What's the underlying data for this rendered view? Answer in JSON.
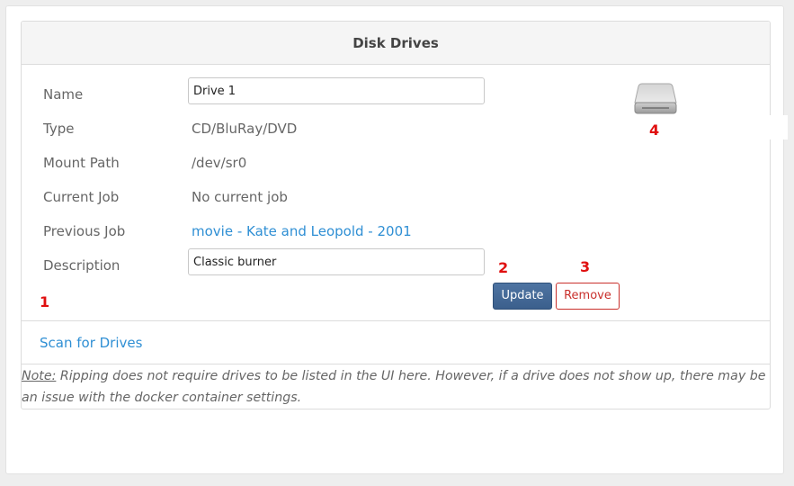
{
  "card": {
    "title": "Disk Drives"
  },
  "drive": {
    "name_label": "Name",
    "name_value": "Drive 1",
    "type_label": "Type",
    "type_value": "CD/BluRay/DVD",
    "mount_label": "Mount Path",
    "mount_value": "/dev/sr0",
    "current_job_label": "Current Job",
    "current_job_value": "No current job",
    "previous_job_label": "Previous Job",
    "previous_job_value": "movie - Kate and Leopold - 2001",
    "description_label": "Description",
    "description_value": "Classic burner",
    "icon": "hard-drive-icon"
  },
  "actions": {
    "update_label": "Update",
    "remove_label": "Remove"
  },
  "markers": {
    "m1": "1",
    "m2": "2",
    "m3": "3",
    "m4": "4"
  },
  "footer": {
    "scan_label": "Scan for Drives",
    "note_label": "Note:",
    "note_text": " Ripping does not require drives to be listed in the UI here. However, if a drive does not show up, there may be an issue with the docker container settings."
  },
  "colors": {
    "link": "#2f8fd4",
    "update_button": "#3b5f8c",
    "remove_button": "#c9302c",
    "marker": "#e01010"
  }
}
